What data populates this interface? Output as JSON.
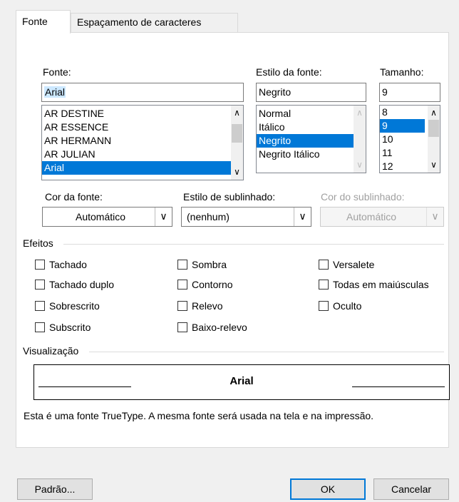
{
  "tabs": [
    {
      "label": "Fonte"
    },
    {
      "label": "Espaçamento de caracteres"
    }
  ],
  "font": {
    "label": "Fonte:",
    "value": "Arial",
    "items": [
      "AR DESTINE",
      "AR ESSENCE",
      "AR HERMANN",
      "AR JULIAN",
      "Arial"
    ],
    "selected": "Arial"
  },
  "style": {
    "label": "Estilo da fonte:",
    "value": "Negrito",
    "items": [
      "Normal",
      "Itálico",
      "Negrito",
      "Negrito Itálico"
    ],
    "selected": "Negrito"
  },
  "size": {
    "label": "Tamanho:",
    "value": "9",
    "items": [
      "8",
      "9",
      "10",
      "11",
      "12"
    ],
    "selected": "9"
  },
  "color": {
    "label": "Cor da fonte:",
    "value": "Automático"
  },
  "underline_style": {
    "label": "Estilo de sublinhado:",
    "value": "(nenhum)"
  },
  "underline_color": {
    "label": "Cor do sublinhado:",
    "value": "Automático"
  },
  "effects": {
    "title": "Efeitos",
    "items": [
      {
        "label": "Tachado",
        "checked": false
      },
      {
        "label": "Tachado duplo",
        "checked": false
      },
      {
        "label": "Sobrescrito",
        "checked": false
      },
      {
        "label": "Subscrito",
        "checked": false
      },
      {
        "label": "Sombra",
        "checked": false
      },
      {
        "label": "Contorno",
        "checked": false
      },
      {
        "label": "Relevo",
        "checked": false
      },
      {
        "label": "Baixo-relevo",
        "checked": false
      },
      {
        "label": "Versalete",
        "checked": false
      },
      {
        "label": "Todas em maiúsculas",
        "checked": false
      },
      {
        "label": "Oculto",
        "checked": false
      }
    ]
  },
  "preview": {
    "title": "Visualização",
    "sample": "Arial",
    "note": "Esta é uma fonte TrueType. A mesma fonte será usada na tela e na impressão."
  },
  "buttons": {
    "default": "Padrão...",
    "ok": "OK",
    "cancel": "Cancelar"
  },
  "colors": {
    "selection": "#0078d7",
    "text_highlight": "#cce8ff",
    "dialog_bg": "#f0f0f0"
  }
}
